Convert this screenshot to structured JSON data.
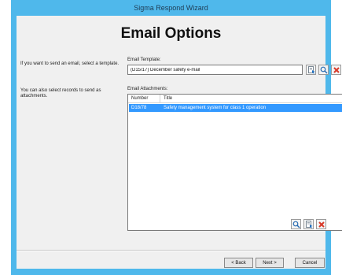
{
  "window": {
    "title": "Sigma Respond Wizard"
  },
  "page": {
    "heading": "Email Options"
  },
  "hints": {
    "template": "If you want to send an email, select a template.",
    "attachments": "You can also select records to send as attachments."
  },
  "template": {
    "label": "Email Template:",
    "value": "(D15/17) December safety e-mail"
  },
  "attachments": {
    "label": "Email Attachments:",
    "columns": [
      "Number",
      "Title"
    ],
    "rows": [
      {
        "number": "D18/78",
        "title": "Safety management system for class 1 operation",
        "selected": true
      }
    ]
  },
  "footer": {
    "back": "< Back",
    "next": "Next >",
    "cancel": "Cancel"
  },
  "colors": {
    "window_frame": "#4fb8eb",
    "selection": "#3399ff",
    "delete_red": "#d83a2a"
  }
}
